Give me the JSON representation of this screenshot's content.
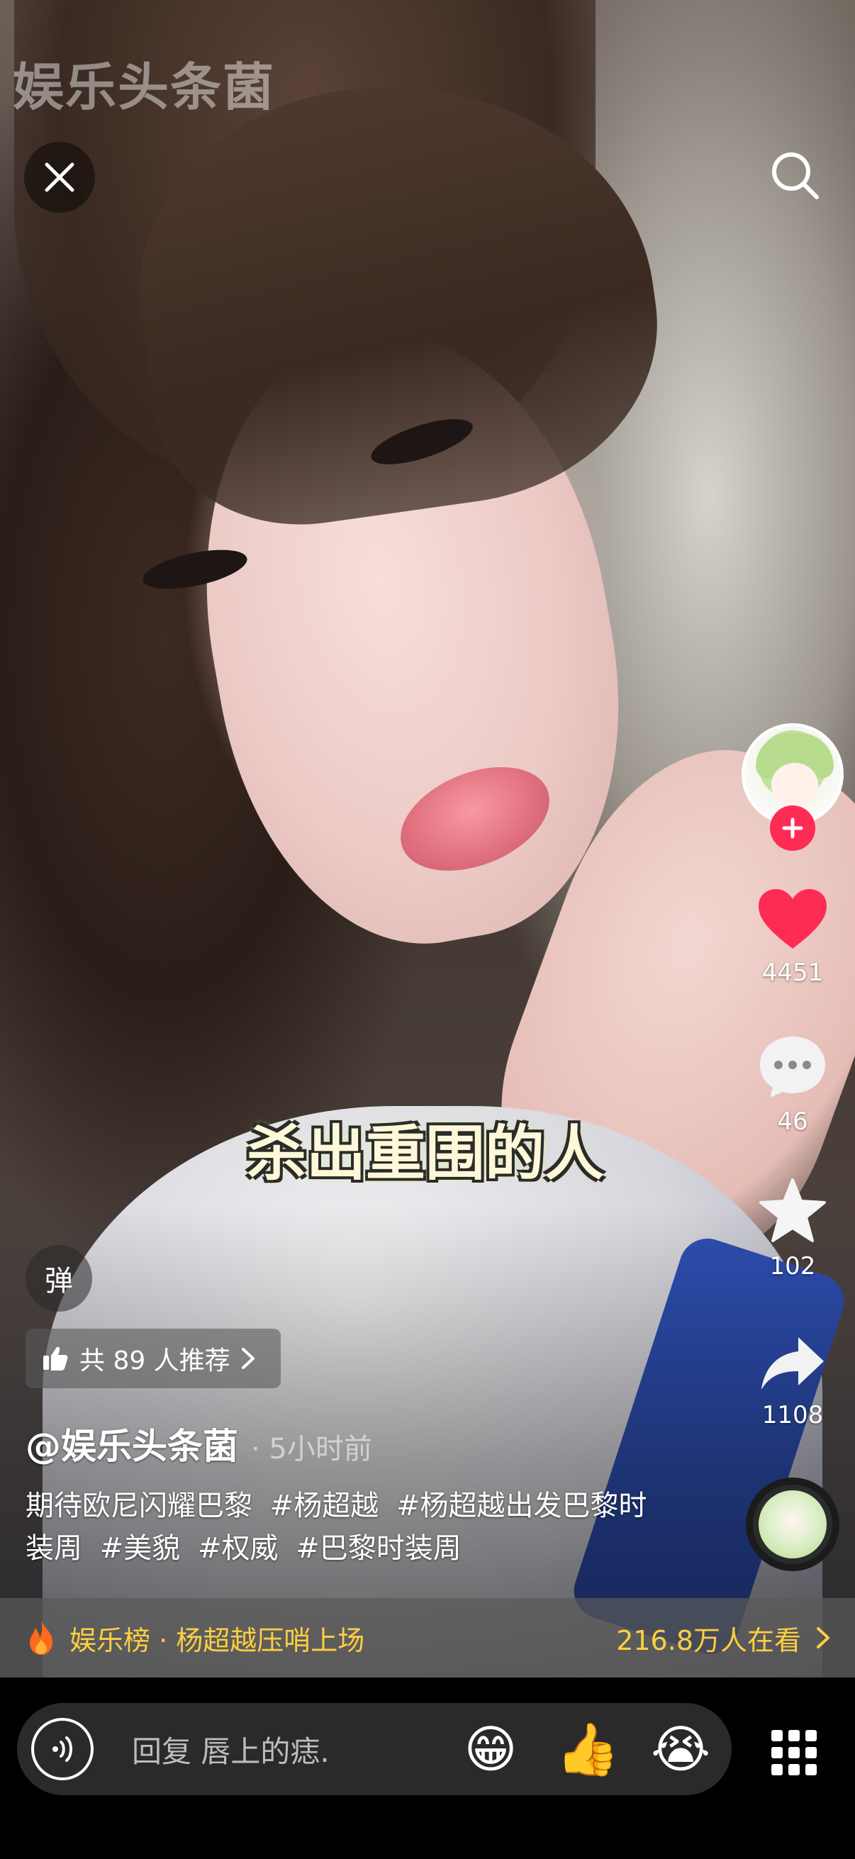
{
  "watermark": "娱乐头条菌",
  "subtitle": "杀出重围的人",
  "actions": {
    "likes": "4451",
    "comments": "46",
    "favorites": "102",
    "shares": "1108"
  },
  "danmu_label": "弹",
  "recommend": {
    "label": "共 89 人推荐"
  },
  "author": {
    "name": "@娱乐头条菌",
    "time": "· 5小时前"
  },
  "description": {
    "text": "期待欧尼闪耀巴黎",
    "tags": [
      "#杨超越",
      "#杨超越出发巴黎时装周",
      "#美貌",
      "#权威",
      "#巴黎时装周"
    ]
  },
  "hot": {
    "ranking": "娱乐榜 · 杨超越压哨上场",
    "watching": "216.8万人在看"
  },
  "reply": {
    "placeholder": "回复 唇上的痣."
  },
  "emojis": [
    "😁",
    "👍",
    "😭"
  ],
  "colors": {
    "like": "#fe2c55",
    "follow": "#fe2c55",
    "hot": "#ffcf3f",
    "flame": "#ff6a1a"
  }
}
